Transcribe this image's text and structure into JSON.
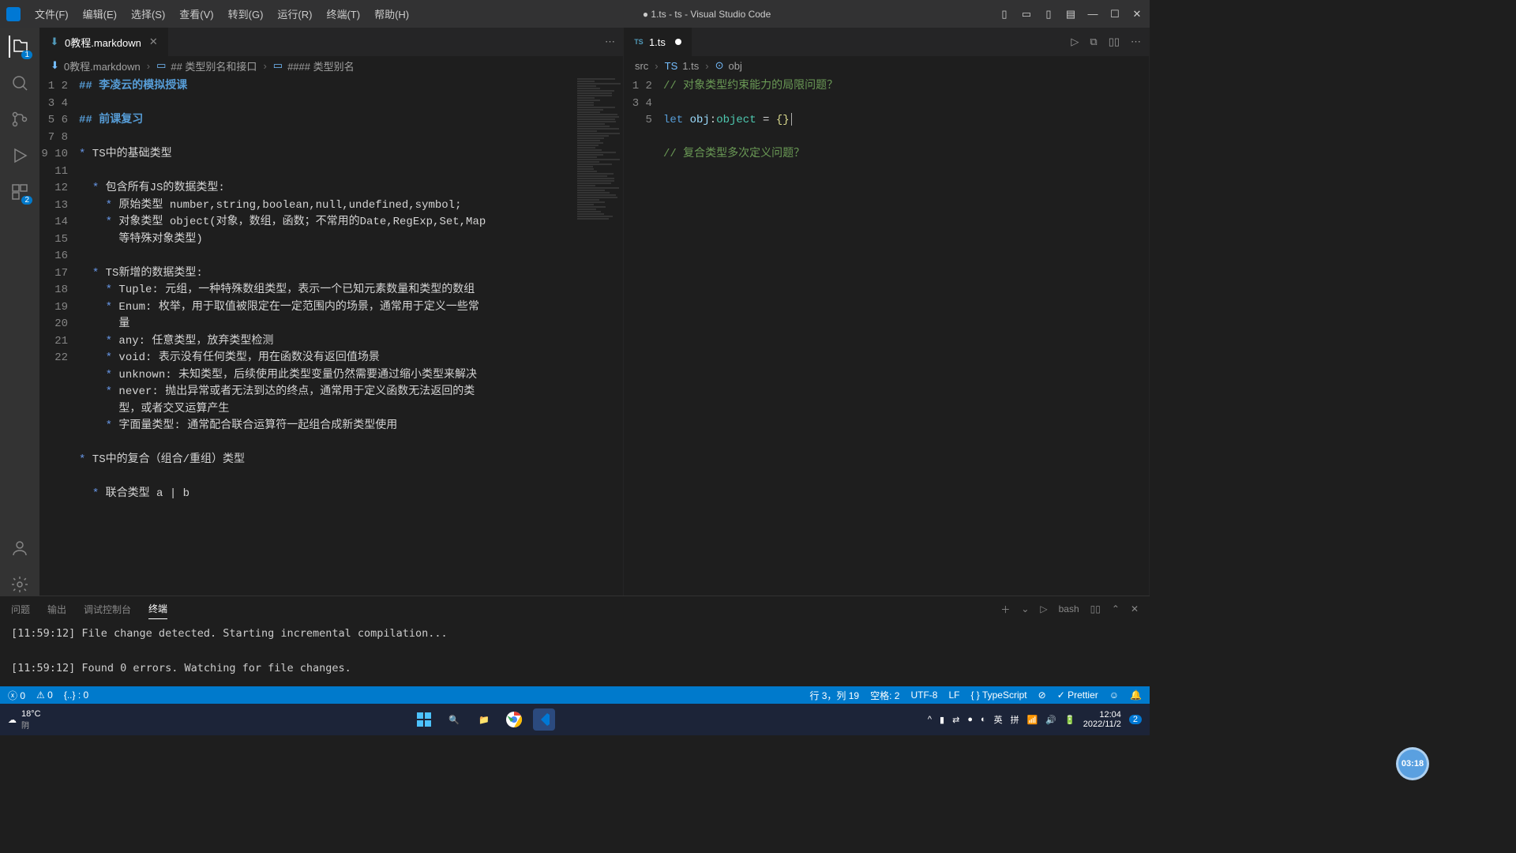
{
  "window": {
    "title": "● 1.ts - ts - Visual Studio Code"
  },
  "menu": [
    "文件(F)",
    "编辑(E)",
    "选择(S)",
    "查看(V)",
    "转到(G)",
    "运行(R)",
    "终端(T)",
    "帮助(H)"
  ],
  "activity_badges": {
    "explorer": "1",
    "extensions": "2"
  },
  "left_editor": {
    "tab": {
      "icon": "⬇",
      "label": "0教程.markdown"
    },
    "breadcrumb": [
      "0教程.markdown",
      "## 类型别名和接口",
      "#### 类型别名"
    ],
    "lines": [
      {
        "n": "1",
        "html": "<span class='md-h'>## 李凌云的模拟授课</span>"
      },
      {
        "n": "2",
        "html": ""
      },
      {
        "n": "3",
        "html": "<span class='md-h'>## 前课复习</span>"
      },
      {
        "n": "4",
        "html": ""
      },
      {
        "n": "5",
        "html": "<span class='md-bullet'>*</span> TS中的基础类型"
      },
      {
        "n": "6",
        "html": ""
      },
      {
        "n": "7",
        "html": "  <span class='md-bullet'>*</span> 包含所有JS的数据类型:"
      },
      {
        "n": "8",
        "html": "    <span class='md-bullet'>*</span> 原始类型 number,string,boolean,null,undefined,symbol;"
      },
      {
        "n": "9",
        "html": "    <span class='md-bullet'>*</span> 对象类型 object(对象，数组，函数；不常用的Date,RegExp,Set,Map\n      等特殊对象类型)"
      },
      {
        "n": "10",
        "html": ""
      },
      {
        "n": "11",
        "html": "  <span class='md-bullet'>*</span> TS新增的数据类型:"
      },
      {
        "n": "12",
        "html": "    <span class='md-bullet'>*</span> Tuple: 元组，一种特殊数组类型，表示一个已知元素数量和类型的数组"
      },
      {
        "n": "13",
        "html": "    <span class='md-bullet'>*</span> Enum: 枚举，用于取值被限定在一定范围内的场景，通常用于定义一些常\n      量"
      },
      {
        "n": "14",
        "html": "    <span class='md-bullet'>*</span> any: 任意类型，放弃类型检测"
      },
      {
        "n": "15",
        "html": "    <span class='md-bullet'>*</span> void: 表示没有任何类型，用在函数没有返回值场景"
      },
      {
        "n": "16",
        "html": "    <span class='md-bullet'>*</span> unknown: 未知类型，后续使用此类型变量仍然需要通过缩小类型来解决"
      },
      {
        "n": "17",
        "html": "    <span class='md-bullet'>*</span> never: 抛出异常或者无法到达的终点，通常用于定义函数无法返回的类\n      型，或者交叉运算产生"
      },
      {
        "n": "18",
        "html": "    <span class='md-bullet'>*</span> 字面量类型: 通常配合联合运算符一起组合成新类型使用"
      },
      {
        "n": "19",
        "html": ""
      },
      {
        "n": "20",
        "html": "<span class='md-bullet'>*</span> TS中的复合（组合/重组）类型"
      },
      {
        "n": "21",
        "html": ""
      },
      {
        "n": "22",
        "html": "  <span class='md-bullet'>*</span> 联合类型 a | b"
      }
    ]
  },
  "right_editor": {
    "tab": {
      "icon": "TS",
      "label": "1.ts"
    },
    "breadcrumb": [
      "src",
      "1.ts",
      "obj"
    ],
    "lines": [
      {
        "n": "1",
        "html": "<span class='comment'>// 对象类型约束能力的局限问题？</span>"
      },
      {
        "n": "2",
        "html": ""
      },
      {
        "n": "3",
        "html": "<span class='kw'>let</span> <span class='varname'>obj</span>:<span class='typename'>object</span> <span class='op'>=</span> <span class='brace'>{}</span><span class='cursor'></span>"
      },
      {
        "n": "4",
        "html": ""
      },
      {
        "n": "5",
        "html": "<span class='comment'>// 复合类型多次定义问题？</span>"
      }
    ]
  },
  "panel": {
    "tabs": [
      "问题",
      "输出",
      "调试控制台",
      "终端"
    ],
    "active": "终端",
    "shell": "bash",
    "output": "[11:59:12] File change detected. Starting incremental compilation...\n\n[11:59:12] Found 0 errors. Watching for file changes."
  },
  "statusbar": {
    "errors": "0",
    "warnings": "0",
    "bracket": "{..} : 0",
    "ln_col": "行 3，列 19",
    "spaces": "空格: 2",
    "encoding": "UTF-8",
    "eol": "LF",
    "lang": "TypeScript",
    "formatter": "Prettier"
  },
  "taskbar": {
    "temp": "18°C",
    "weather": "阴",
    "ime1": "英",
    "ime2": "拼",
    "time": "12:04",
    "date": "2022/11/2",
    "notif": "2"
  },
  "recorder": "03:18"
}
